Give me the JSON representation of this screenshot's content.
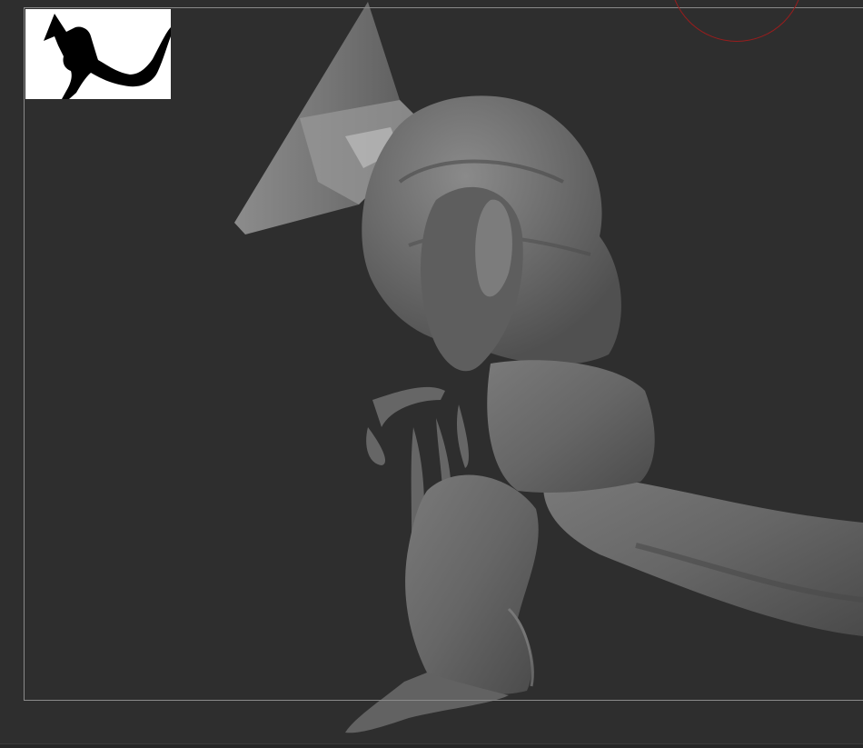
{
  "viewport": {
    "background_color": "#2e2e2e",
    "frame_color": "#8a8a8a"
  },
  "thumbnail": {
    "icon": "silhouette-preview-icon",
    "background_color": "#ffffff",
    "silhouette_color": "#000000"
  },
  "model": {
    "icon": "sculpted-creature-mesh",
    "base_color": "#6f6f6f",
    "shadow_color": "#3e3e3e",
    "highlight_color": "#a8a8a8"
  },
  "brush_cursor": {
    "icon": "brush-radius-circle",
    "color": "#9a1d1d"
  }
}
